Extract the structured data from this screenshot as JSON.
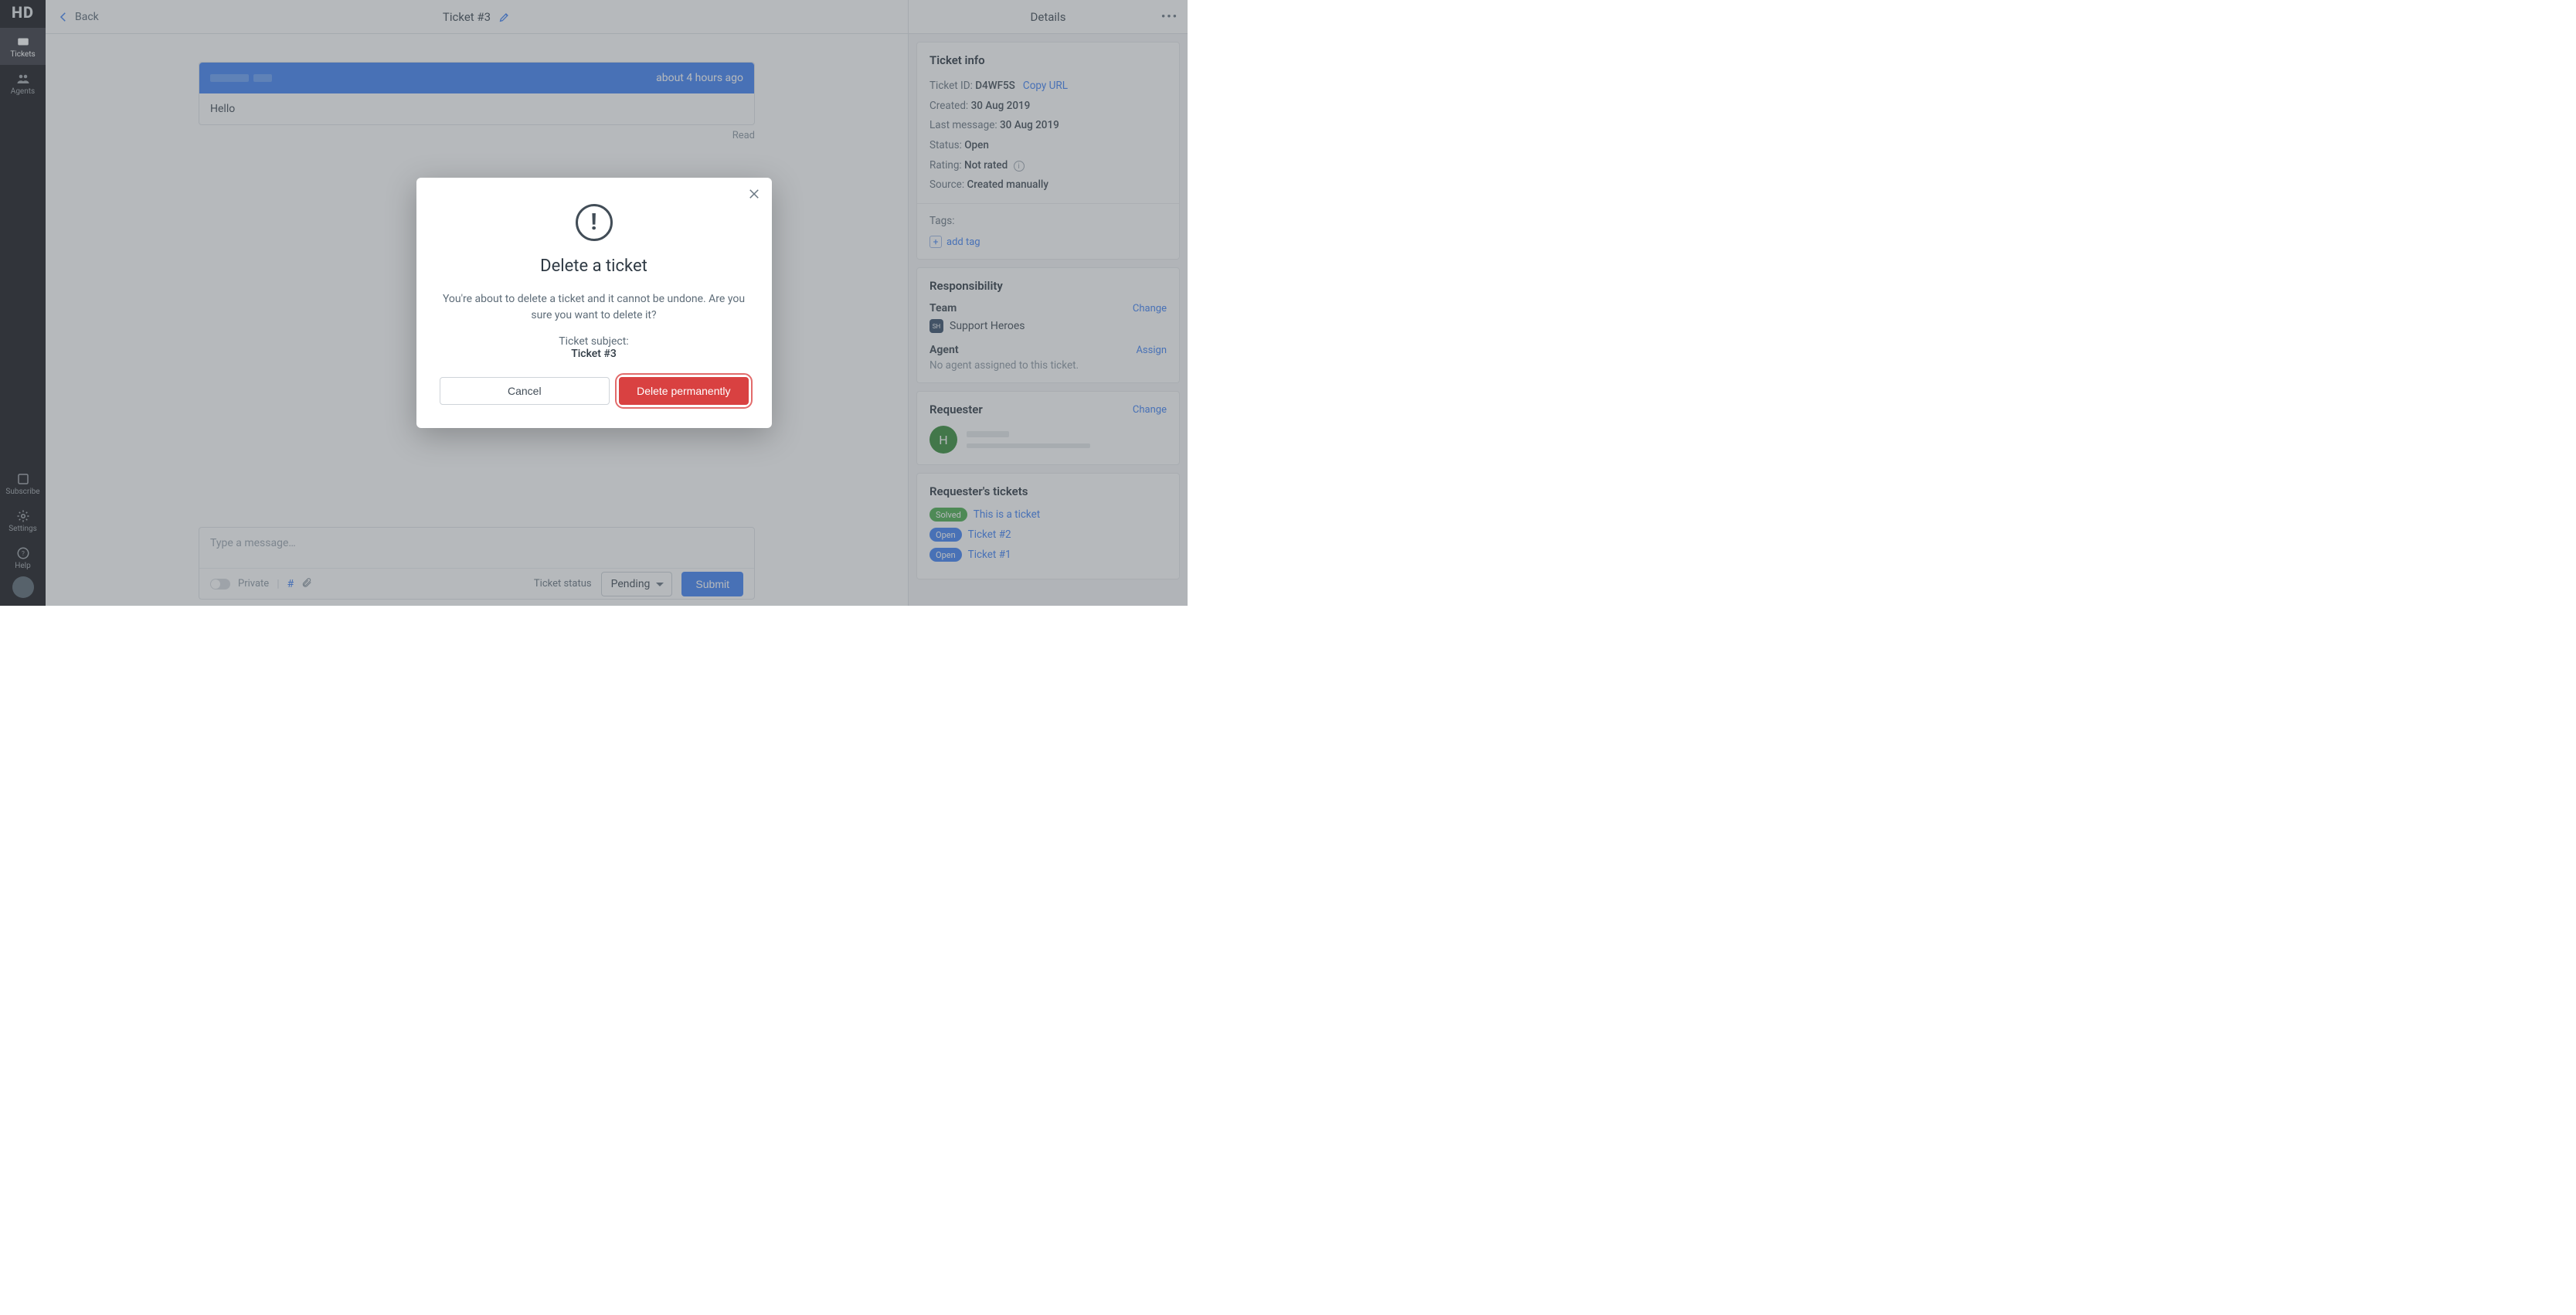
{
  "rail": {
    "logo": "HD",
    "items": [
      {
        "icon": "ticket",
        "label": "Tickets",
        "active": true
      },
      {
        "icon": "agents",
        "label": "Agents",
        "active": false
      }
    ],
    "bottom": [
      {
        "icon": "subscribe",
        "label": "Subscribe"
      },
      {
        "icon": "settings",
        "label": "Settings"
      },
      {
        "icon": "help",
        "label": "Help"
      }
    ]
  },
  "header": {
    "back": "Back",
    "title": "Ticket #3"
  },
  "message": {
    "time": "about 4 hours ago",
    "body": "Hello",
    "read": "Read"
  },
  "composer": {
    "placeholder": "Type a message…",
    "private": "Private",
    "status_label": "Ticket status",
    "status_value": "Pending",
    "submit": "Submit"
  },
  "details": {
    "title": "Details",
    "ticket_info": {
      "heading": "Ticket info",
      "id_label": "Ticket ID:",
      "id_value": "D4WF5S",
      "copy": "Copy URL",
      "created_label": "Created:",
      "created_value": "30 Aug 2019",
      "last_label": "Last message:",
      "last_value": "30 Aug 2019",
      "status_label": "Status:",
      "status_value": "Open",
      "rating_label": "Rating:",
      "rating_value": "Not rated",
      "source_label": "Source:",
      "source_value": "Created manually",
      "tags_label": "Tags:",
      "add_tag": "add tag"
    },
    "responsibility": {
      "heading": "Responsibility",
      "team_label": "Team",
      "team_change": "Change",
      "team_name": "Support Heroes",
      "team_badge": "SH",
      "agent_label": "Agent",
      "agent_assign": "Assign",
      "agent_none": "No agent assigned to this ticket."
    },
    "requester": {
      "heading": "Requester",
      "change": "Change",
      "initial": "H"
    },
    "requester_tickets": {
      "heading": "Requester's tickets",
      "rows": [
        {
          "status": "Solved",
          "cls": "solved",
          "title": "This is a ticket"
        },
        {
          "status": "Open",
          "cls": "open",
          "title": "Ticket #2"
        },
        {
          "status": "Open",
          "cls": "open",
          "title": "Ticket #1"
        }
      ]
    }
  },
  "modal": {
    "title": "Delete a ticket",
    "body": "You're about to delete a ticket and it cannot be undone. Are you sure you want to delete it?",
    "subject_label": "Ticket subject:",
    "subject_value": "Ticket #3",
    "cancel": "Cancel",
    "delete": "Delete permanently"
  }
}
